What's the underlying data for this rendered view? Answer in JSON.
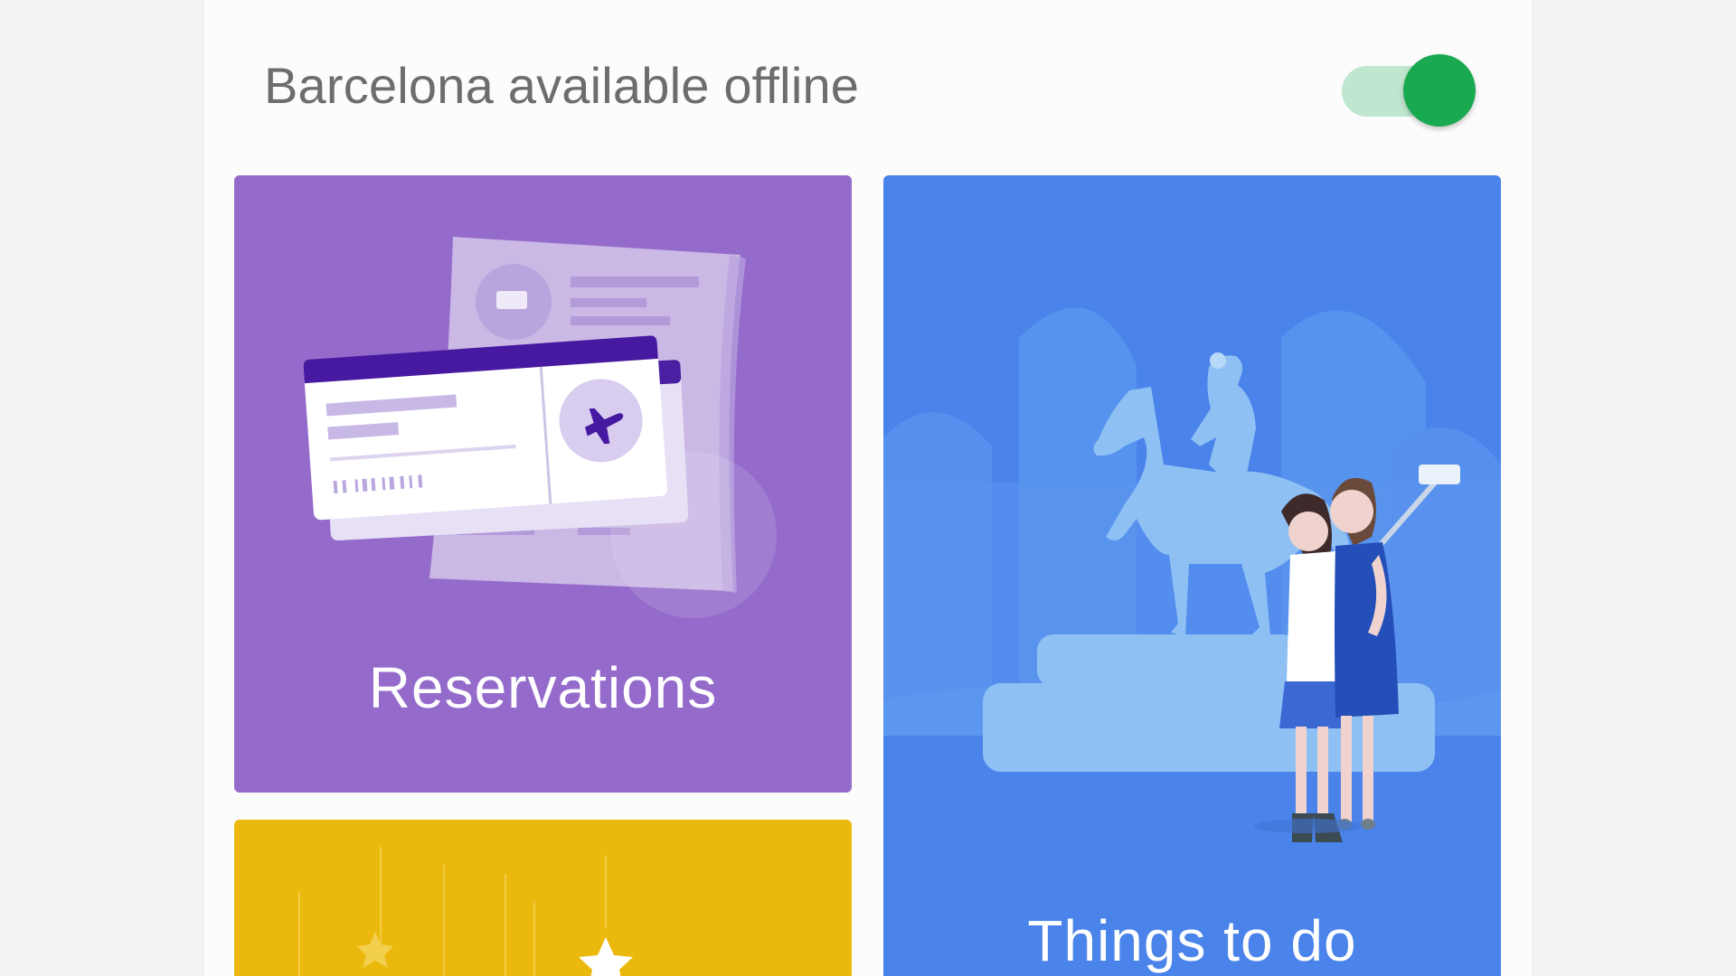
{
  "header": {
    "title": "Barcelona available offline",
    "offline_toggle": {
      "on": true
    }
  },
  "colors": {
    "panel_bg": "#fcfcfc",
    "page_bg": "#f2f2f2",
    "toggle_track": "#bfe6cf",
    "toggle_knob": "#19a950",
    "reservations": "#946bcb",
    "things_to_do": "#4a83ea",
    "third_card": "#ebb90d"
  },
  "cards": {
    "reservations": {
      "label": "Reservations",
      "icon": "reservations-illustration"
    },
    "things_to_do": {
      "label": "Things to do",
      "icon": "things-to-do-illustration"
    },
    "third": {
      "label": "",
      "icon": "stars-illustration"
    }
  }
}
